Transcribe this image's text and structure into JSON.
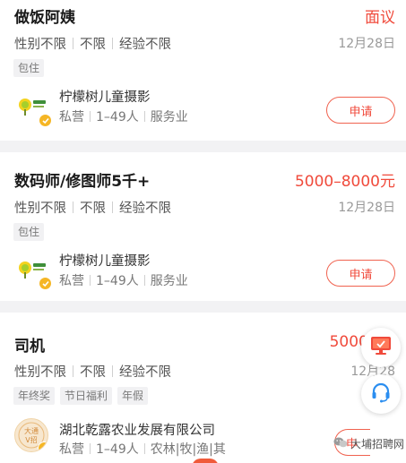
{
  "colors": {
    "accent": "#f04a3b",
    "verified": "#f5b625",
    "background": "#f2f2f4"
  },
  "jobs": [
    {
      "title": "做饭阿姨",
      "salary": "面议",
      "reqs": [
        "性别不限",
        "不限",
        "经验不限"
      ],
      "date": "12月28日",
      "tags": [
        "包住"
      ],
      "company": {
        "name": "柠檬树儿童摄影",
        "info": [
          "私营",
          "1–49人",
          "服务业"
        ],
        "logo": "lemon-tree-logo"
      },
      "apply_label": "申请"
    },
    {
      "title": "数码师/修图师5千+",
      "salary": "5000–8000元",
      "reqs": [
        "性别不限",
        "不限",
        "经验不限"
      ],
      "date": "12月28日",
      "tags": [
        "包住"
      ],
      "company": {
        "name": "柠檬树儿童摄影",
        "info": [
          "私营",
          "1–49人",
          "服务业"
        ],
        "logo": "lemon-tree-logo"
      },
      "apply_label": "申请"
    },
    {
      "title": "司机",
      "salary": "5000–80",
      "reqs": [
        "性别不限",
        "不限",
        "经验不限"
      ],
      "date": "12月28",
      "tags": [
        "年终奖",
        "节日福利",
        "年假"
      ],
      "company": {
        "name": "湖北乾露农业发展有限公司",
        "info": [
          "私营",
          "1–49人",
          "农林|牧|渔|其"
        ],
        "logo": "company-badge-logo",
        "logo_text": "大通V招"
      },
      "apply_label": "申"
    }
  ],
  "floating": {
    "top_icon": "monitor-icon",
    "bottom_icon": "headset-icon"
  },
  "watermark": {
    "icon": "wechat-icon",
    "text": "大埔招聘网"
  }
}
